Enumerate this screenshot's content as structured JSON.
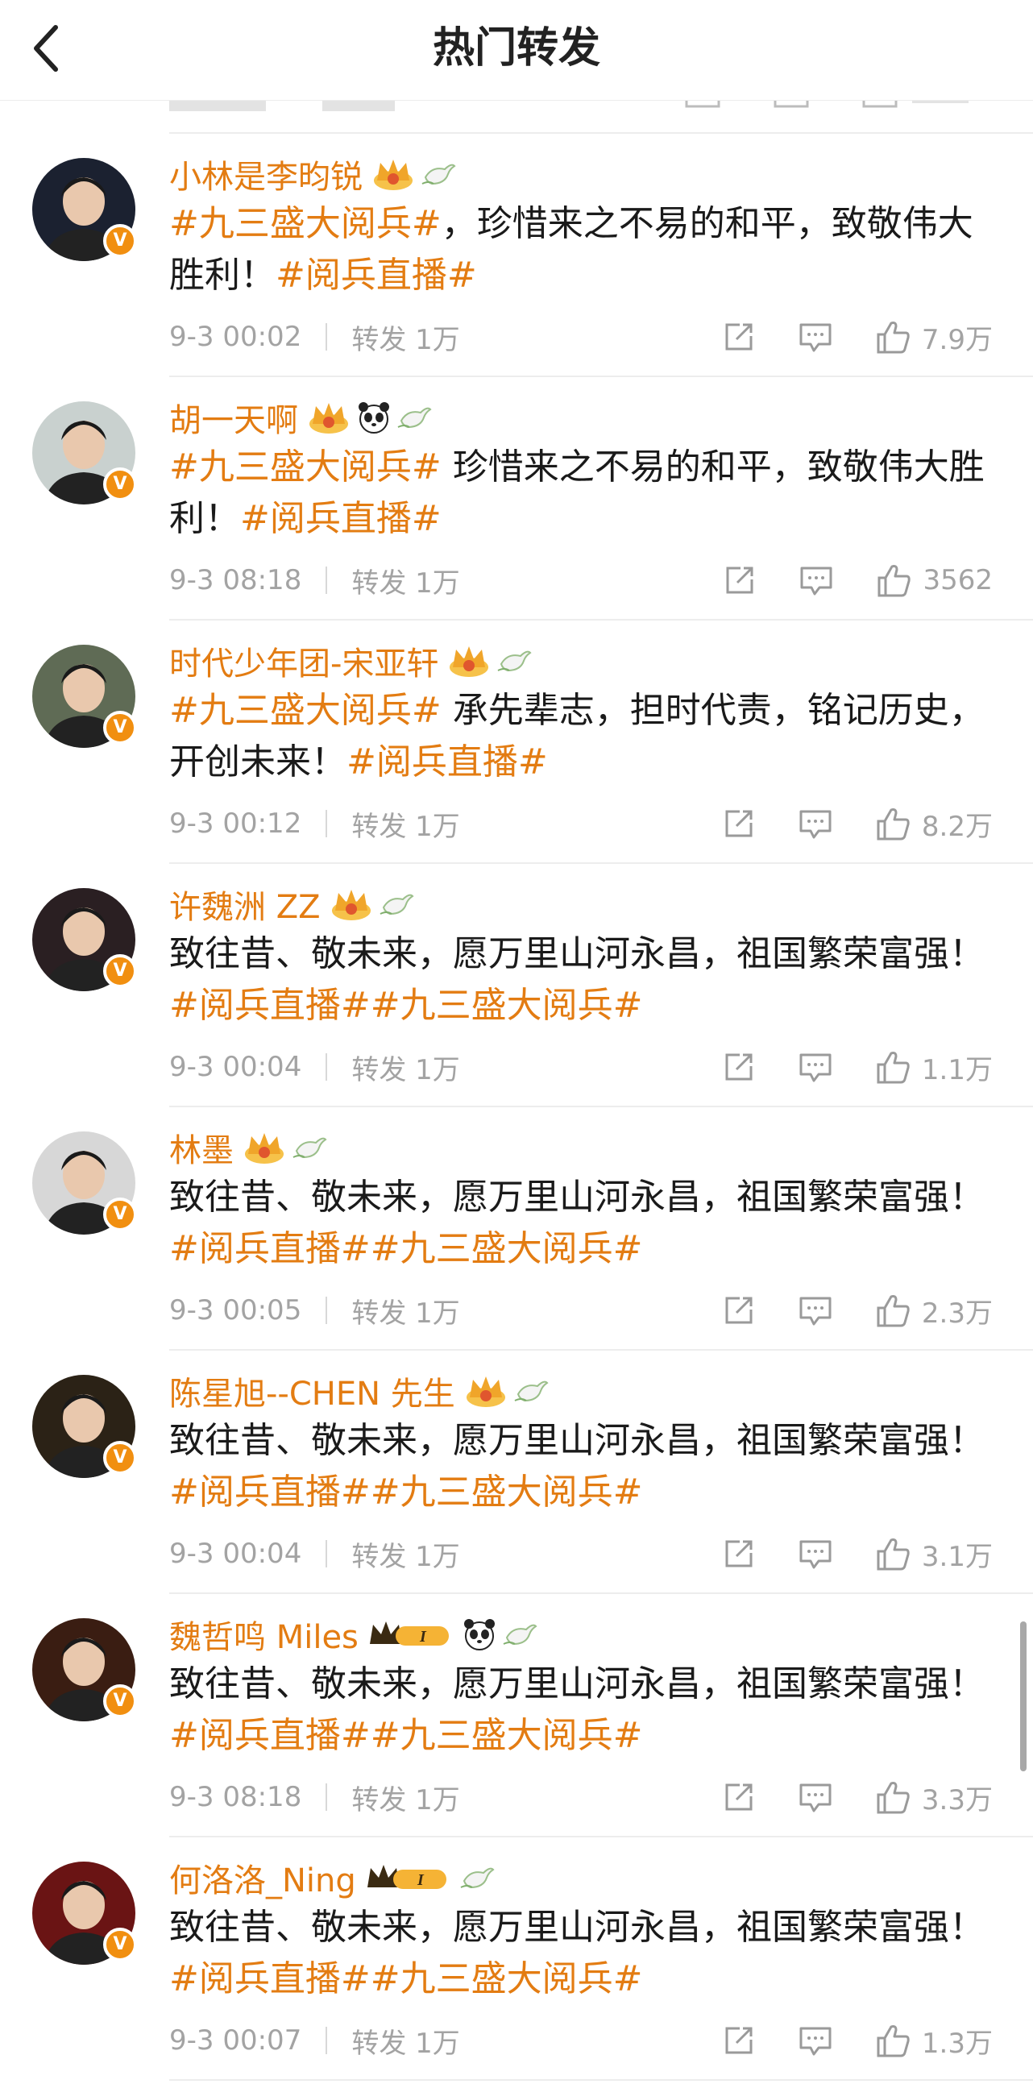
{
  "header": {
    "title": "热门转发"
  },
  "posts": [
    {
      "name": "小林是李昀锐",
      "content": [
        {
          "t": "#九三盛大阅兵#",
          "tag": true
        },
        {
          "t": "，珍惜来之不易的和平，致敬伟大胜利！"
        },
        {
          "t": "#阅兵直播#",
          "tag": true
        }
      ],
      "time": "9-3 00:02",
      "repost": "转发 1万",
      "likes": "7.9万",
      "badges": [
        "crown",
        "dove"
      ],
      "avatar_color": "#1b2130"
    },
    {
      "name": "胡一天啊",
      "content": [
        {
          "t": "#九三盛大阅兵#",
          "tag": true
        },
        {
          "t": " 珍惜来之不易的和平，致敬伟大胜利！"
        },
        {
          "t": "#阅兵直播#",
          "tag": true
        }
      ],
      "time": "9-3 08:18",
      "repost": "转发 1万",
      "likes": "3562",
      "badges": [
        "crown",
        "panda",
        "dove"
      ],
      "avatar_color": "#c9d1cf"
    },
    {
      "name": "时代少年团-宋亚轩",
      "content": [
        {
          "t": "#九三盛大阅兵#",
          "tag": true
        },
        {
          "t": " 承先辈志，担时代责，铭记历史，开创未来！"
        },
        {
          "t": "#阅兵直播#",
          "tag": true
        }
      ],
      "time": "9-3 00:12",
      "repost": "转发 1万",
      "likes": "8.2万",
      "badges": [
        "crown",
        "dove"
      ],
      "avatar_color": "#5f6b55"
    },
    {
      "name": "许魏洲 ZZ",
      "content": [
        {
          "t": "致往昔、敬未来，愿万里山河永昌，祖国繁荣富强！"
        },
        {
          "t": "#阅兵直播##九三盛大阅兵#",
          "tag": true
        }
      ],
      "time": "9-3 00:04",
      "repost": "转发 1万",
      "likes": "1.1万",
      "badges": [
        "crown",
        "dove"
      ],
      "avatar_color": "#2a1f22"
    },
    {
      "name": "林墨",
      "content": [
        {
          "t": "致往昔、敬未来，愿万里山河永昌，祖国繁荣富强！"
        },
        {
          "t": "#阅兵直播##九三盛大阅兵#",
          "tag": true
        }
      ],
      "time": "9-3 00:05",
      "repost": "转发 1万",
      "likes": "2.3万",
      "badges": [
        "crown",
        "dove"
      ],
      "avatar_color": "#d7d7d7"
    },
    {
      "name": "陈星旭--CHEN 先生",
      "content": [
        {
          "t": "致往昔、敬未来，愿万里山河永昌，祖国繁荣富强！"
        },
        {
          "t": "#阅兵直播##九三盛大阅兵#",
          "tag": true
        }
      ],
      "time": "9-3 00:04",
      "repost": "转发 1万",
      "likes": "3.1万",
      "badges": [
        "crown",
        "dove"
      ],
      "avatar_color": "#2b2216"
    },
    {
      "name": "魏哲鸣 Miles",
      "content": [
        {
          "t": "致往昔、敬未来，愿万里山河永昌，祖国繁荣富强！"
        },
        {
          "t": "#阅兵直播##九三盛大阅兵#",
          "tag": true
        }
      ],
      "time": "9-3 08:18",
      "repost": "转发 1万",
      "likes": "3.3万",
      "badges": [
        "crown-level",
        "panda",
        "dove"
      ],
      "avatar_color": "#3a1d12"
    },
    {
      "name": "何洛洛_Ning",
      "content": [
        {
          "t": "致往昔、敬未来，愿万里山河永昌，祖国繁荣富强！"
        },
        {
          "t": "#阅兵直播##九三盛大阅兵#",
          "tag": true
        }
      ],
      "time": "9-3 00:07",
      "repost": "转发 1万",
      "likes": "1.3万",
      "badges": [
        "crown-level",
        "dove"
      ],
      "avatar_color": "#6a1414"
    }
  ],
  "colors": {
    "accent": "#e37c12",
    "meta": "#a3a3a3",
    "vip": "#f18f10"
  },
  "icons": {
    "back": "chevron-left-icon",
    "repost": "share-icon",
    "comment": "comment-icon",
    "like": "thumb-up-icon"
  }
}
